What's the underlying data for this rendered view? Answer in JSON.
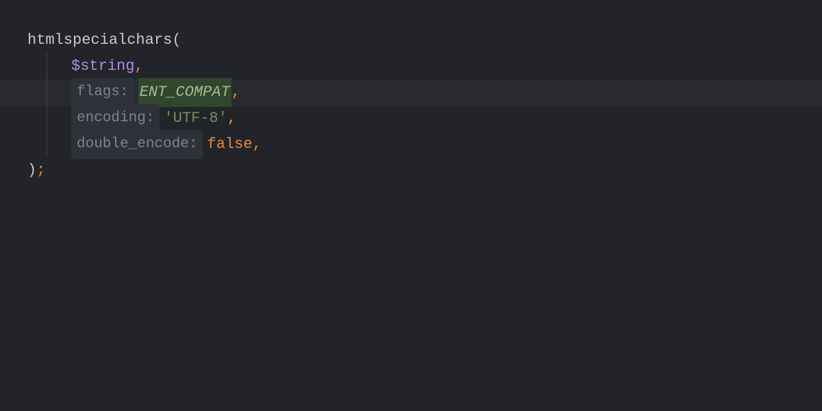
{
  "code": {
    "function_name": "htmlspecialchars",
    "open_paren": "(",
    "arg1": {
      "variable": "$string",
      "comma": ","
    },
    "arg2": {
      "hint": "flags:",
      "value": "ENT_COMPAT",
      "comma": ","
    },
    "arg3": {
      "hint": "encoding:",
      "value": "'UTF-8'",
      "comma": ","
    },
    "arg4": {
      "hint": "double_encode:",
      "value": "false",
      "comma": ","
    },
    "close_paren": ")",
    "semicolon": ";"
  }
}
